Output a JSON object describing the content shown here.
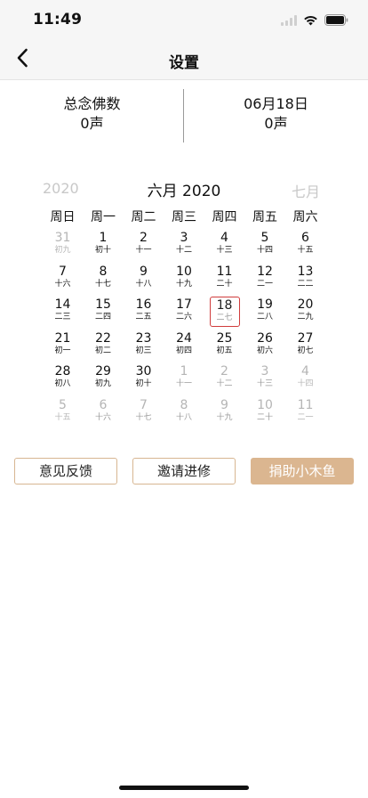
{
  "status_bar": {
    "time": "11:49"
  },
  "nav": {
    "title": "设置"
  },
  "stats": {
    "left": {
      "label": "总念佛数",
      "value": "0声"
    },
    "right": {
      "label": "06月18日",
      "value": "0声"
    }
  },
  "calendar": {
    "prev_label": "2020",
    "title": "六月 2020",
    "next_label": "七月",
    "weekdays": [
      "周日",
      "周一",
      "周二",
      "周三",
      "周四",
      "周五",
      "周六"
    ],
    "weeks": [
      [
        {
          "d": "31",
          "l": "初九",
          "s": "dim"
        },
        {
          "d": "1",
          "l": "初十",
          "s": "cur"
        },
        {
          "d": "2",
          "l": "十一",
          "s": "cur"
        },
        {
          "d": "3",
          "l": "十二",
          "s": "cur"
        },
        {
          "d": "4",
          "l": "十三",
          "s": "cur"
        },
        {
          "d": "5",
          "l": "十四",
          "s": "cur"
        },
        {
          "d": "6",
          "l": "十五",
          "s": "cur"
        }
      ],
      [
        {
          "d": "7",
          "l": "十六",
          "s": "cur"
        },
        {
          "d": "8",
          "l": "十七",
          "s": "cur"
        },
        {
          "d": "9",
          "l": "十八",
          "s": "cur"
        },
        {
          "d": "10",
          "l": "十九",
          "s": "cur"
        },
        {
          "d": "11",
          "l": "二十",
          "s": "cur"
        },
        {
          "d": "12",
          "l": "二一",
          "s": "cur"
        },
        {
          "d": "13",
          "l": "二二",
          "s": "cur"
        }
      ],
      [
        {
          "d": "14",
          "l": "二三",
          "s": "cur"
        },
        {
          "d": "15",
          "l": "二四",
          "s": "cur"
        },
        {
          "d": "16",
          "l": "二五",
          "s": "cur"
        },
        {
          "d": "17",
          "l": "二六",
          "s": "cur"
        },
        {
          "d": "18",
          "l": "二七",
          "s": "sel"
        },
        {
          "d": "19",
          "l": "二八",
          "s": "cur"
        },
        {
          "d": "20",
          "l": "二九",
          "s": "cur"
        }
      ],
      [
        {
          "d": "21",
          "l": "初一",
          "s": "cur"
        },
        {
          "d": "22",
          "l": "初二",
          "s": "cur"
        },
        {
          "d": "23",
          "l": "初三",
          "s": "cur"
        },
        {
          "d": "24",
          "l": "初四",
          "s": "cur"
        },
        {
          "d": "25",
          "l": "初五",
          "s": "cur"
        },
        {
          "d": "26",
          "l": "初六",
          "s": "cur"
        },
        {
          "d": "27",
          "l": "初七",
          "s": "cur"
        }
      ],
      [
        {
          "d": "28",
          "l": "初八",
          "s": "cur"
        },
        {
          "d": "29",
          "l": "初九",
          "s": "cur"
        },
        {
          "d": "30",
          "l": "初十",
          "s": "cur"
        },
        {
          "d": "1",
          "l": "十一",
          "s": "dim"
        },
        {
          "d": "2",
          "l": "十二",
          "s": "dim"
        },
        {
          "d": "3",
          "l": "十三",
          "s": "dim"
        },
        {
          "d": "4",
          "l": "十四",
          "s": "dim"
        }
      ],
      [
        {
          "d": "5",
          "l": "十五",
          "s": "dim"
        },
        {
          "d": "6",
          "l": "十六",
          "s": "dim"
        },
        {
          "d": "7",
          "l": "十七",
          "s": "dim"
        },
        {
          "d": "8",
          "l": "十八",
          "s": "dim"
        },
        {
          "d": "9",
          "l": "十九",
          "s": "dim"
        },
        {
          "d": "10",
          "l": "二十",
          "s": "dim"
        },
        {
          "d": "11",
          "l": "二一",
          "s": "dim"
        }
      ]
    ]
  },
  "buttons": {
    "feedback": "意见反馈",
    "invite": "邀请进修",
    "donate": "捐助小木鱼"
  },
  "colors": {
    "accent": "#dbb690",
    "selected_border": "#d03c3c",
    "dim_text": "#b5b5b5"
  },
  "icons": {
    "back": "chevron-left-icon",
    "signal": "cellular-signal-icon",
    "wifi": "wifi-icon",
    "battery": "battery-icon"
  }
}
